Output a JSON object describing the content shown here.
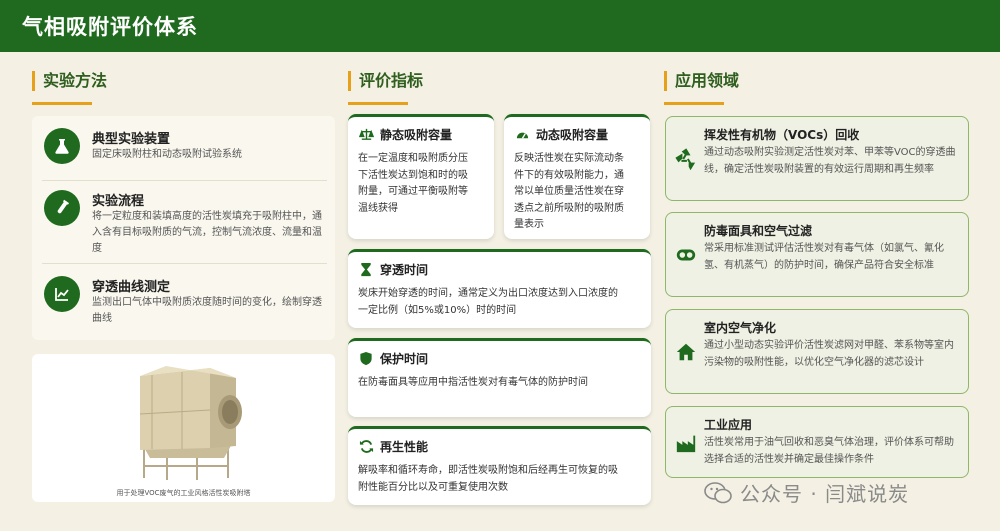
{
  "header": {
    "title": "气相吸附评价体系"
  },
  "sections": {
    "methods": "实验方法",
    "indicators": "评价指标",
    "applications": "应用领域"
  },
  "methods": [
    {
      "title": "典型实验装置",
      "desc": "固定床吸附柱和动态吸附试验系统",
      "icon": "flask-icon"
    },
    {
      "title": "实验流程",
      "desc": "将一定粒度和装填高度的活性炭填充于吸附柱中，通入含有目标吸附质的气流，控制气流浓度、流量和温度",
      "icon": "test-tube-icon"
    },
    {
      "title": "穿透曲线测定",
      "desc": "监测出口气体中吸附质浓度随时间的变化，绘制穿透曲线",
      "icon": "line-chart-icon"
    }
  ],
  "image_caption": "用于处理VOC废气的工业风格活性炭吸附塔",
  "indicators": {
    "static": {
      "title": "静态吸附容量",
      "desc_lines": [
        "在一定温度和吸附质分压",
        "下活性炭达到饱和时的吸",
        "附量，可通过平衡吸附等",
        "温线获得"
      ],
      "icon": "balance-icon"
    },
    "dynamic": {
      "title": "动态吸附容量",
      "desc_lines": [
        "反映活性炭在实际流动条",
        "件下的有效吸附能力，通",
        "常以单位质量活性炭在穿",
        "透点之前所吸附的吸附质",
        "量表示"
      ],
      "icon": "gauge-icon"
    },
    "breakthrough": {
      "title": "穿透时间",
      "desc_lines": [
        "炭床开始穿透的时间，通常定义为出口浓度达到入口浓度的",
        "一定比例（如5%或10%）时的时间"
      ],
      "icon": "hourglass-icon"
    },
    "protection": {
      "title": "保护时间",
      "desc_lines": [
        "在防毒面具等应用中指活性炭对有毒气体的防护时间"
      ],
      "icon": "shield-icon"
    },
    "regeneration": {
      "title": "再生性能",
      "desc_lines": [
        "解吸率和循环寿命，即活性炭吸附饱和后经再生可恢复的吸",
        "附性能百分比以及可重复使用次数"
      ],
      "icon": "refresh-icon"
    }
  },
  "applications": [
    {
      "title": "挥发性有机物（VOCs）回收",
      "desc": "通过动态吸附实验测定活性炭对苯、甲苯等VOC的穿透曲线，确定活性炭吸附装置的有效运行周期和再生频率",
      "icon": "recycle-icon"
    },
    {
      "title": "防毒面具和空气过滤",
      "desc": "常采用标准测试评估活性炭对有毒气体（如氯气、氰化氢、有机蒸气）的防护时间，确保产品符合安全标准",
      "icon": "gas-mask-icon"
    },
    {
      "title": "室内空气净化",
      "desc": "通过小型动态实验评价活性炭滤网对甲醛、苯系物等室内污染物的吸附性能，以优化空气净化器的滤芯设计",
      "icon": "home-icon"
    },
    {
      "title": "工业应用",
      "desc": "活性炭常用于油气回收和恶臭气体治理，评价体系可帮助选择合适的活性炭并确定最佳操作条件",
      "icon": "factory-icon"
    }
  ],
  "watermark": {
    "text": "公众号 · 闫斌说炭",
    "icon": "wechat-icon"
  },
  "colors": {
    "primary": "#1f6a1e",
    "accent": "#e7a01a",
    "background": "#f4f1e4",
    "app_border": "#8fb76a"
  }
}
